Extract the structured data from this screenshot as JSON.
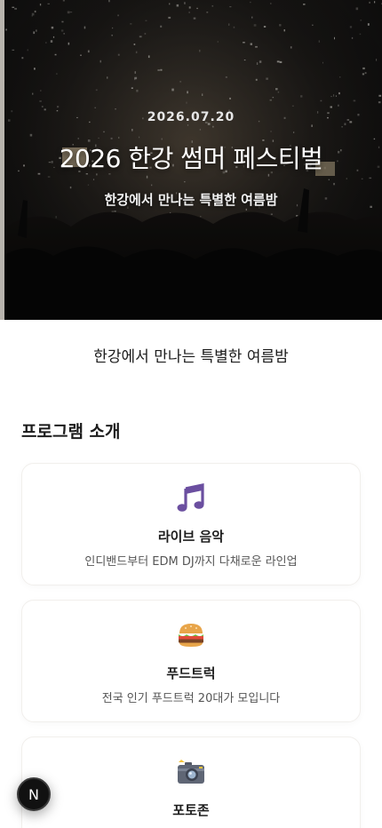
{
  "hero": {
    "date": "2026.07.20",
    "title": "2026 한강 썸머 페스티벌",
    "subtitle": "한강에서 만나는 특별한 여름밤"
  },
  "tagline": "한강에서 만나는 특별한 여름밤",
  "program": {
    "section_title": "프로그램 소개",
    "items": [
      {
        "icon": "music-notes-icon",
        "title": "라이브 음악",
        "description": "인디밴드부터 EDM DJ까지 다채로운 라인업"
      },
      {
        "icon": "burger-icon",
        "title": "푸드트럭",
        "description": "전국 인기 푸드트럭 20대가 모입니다"
      },
      {
        "icon": "camera-icon",
        "title": "포토존",
        "description": ""
      }
    ]
  },
  "badge": {
    "label": "N"
  },
  "colors": {
    "music_icon": "#6b4fa0",
    "hero_text": "#ffffff"
  }
}
